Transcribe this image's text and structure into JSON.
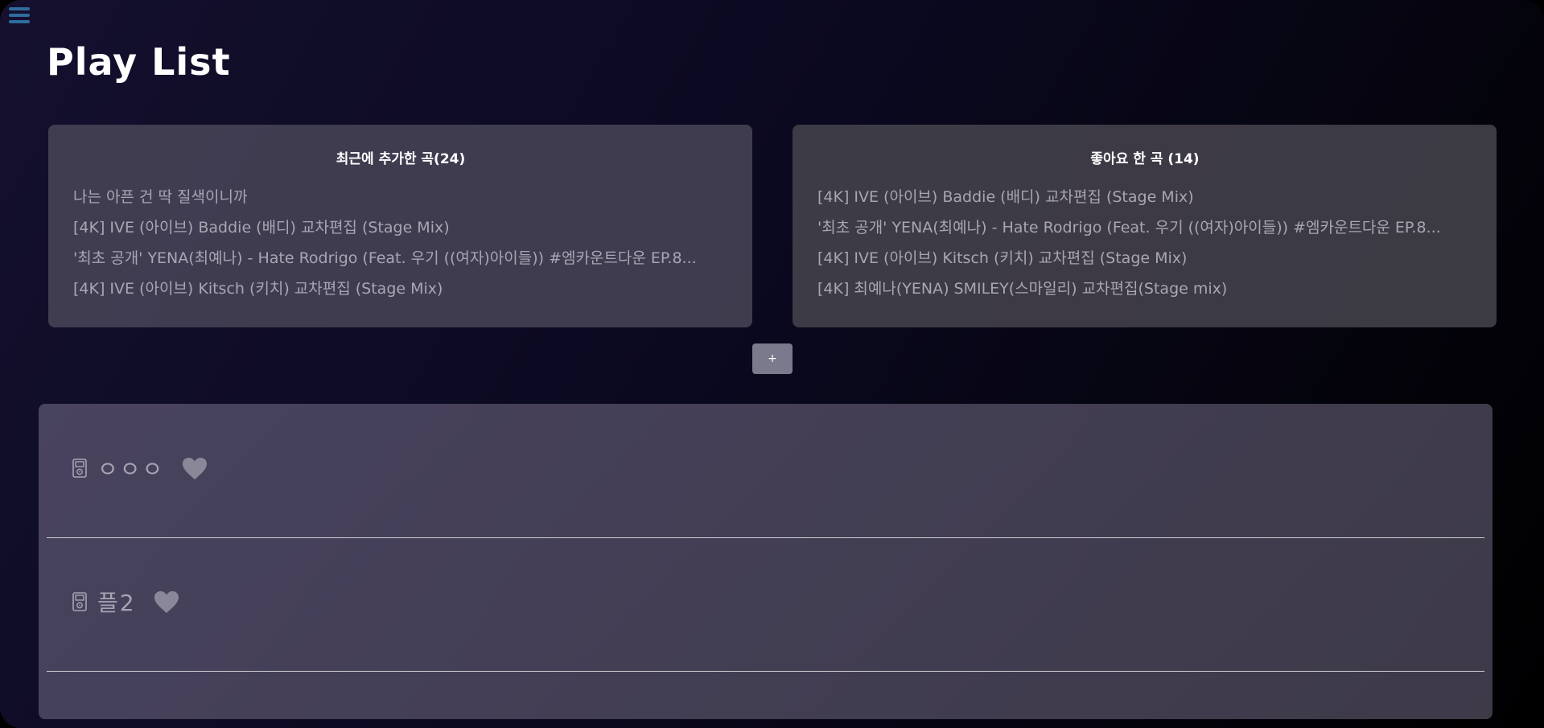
{
  "header": {
    "title": "Play List",
    "menu_icon": "hamburger-menu-icon"
  },
  "cards": [
    {
      "title": "최근에 추가한 곡(24)",
      "items": [
        "나는 아픈 건 딱 질색이니까",
        "[4K] IVE (아이브) Baddie (배디) 교차편집 (Stage Mix)",
        "'최초 공개' YENA(최예나) - Hate Rodrigo (Feat. 우기 ((여자)아이들)) #엠카운트다운 EP.8...",
        "[4K] IVE (아이브) Kitsch (키치) 교차편집 (Stage Mix)"
      ]
    },
    {
      "title": "좋아요 한 곡 (14)",
      "items": [
        "[4K] IVE (아이브) Baddie (배디) 교차편집 (Stage Mix)",
        "'최초 공개' YENA(최예나) - Hate Rodrigo (Feat. 우기 ((여자)아이들)) #엠카운트다운 EP.8...",
        "[4K] IVE (아이브) Kitsch (키치) 교차편집 (Stage Mix)",
        "[4K] 최예나(YENA) SMILEY(스마일리) 교차편집(Stage mix)"
      ]
    }
  ],
  "add_button": {
    "label": "+"
  },
  "playlists": [
    {
      "name": "ㅇㅇㅇ",
      "icon": "music-player-icon",
      "favorite_icon": "heart-icon"
    },
    {
      "name": "플2",
      "icon": "music-player-icon",
      "favorite_icon": "heart-icon"
    }
  ],
  "colors": {
    "accent_menu": "#2f6d9e",
    "card_text": "#a9a6b3",
    "heart": "#8a8898"
  }
}
